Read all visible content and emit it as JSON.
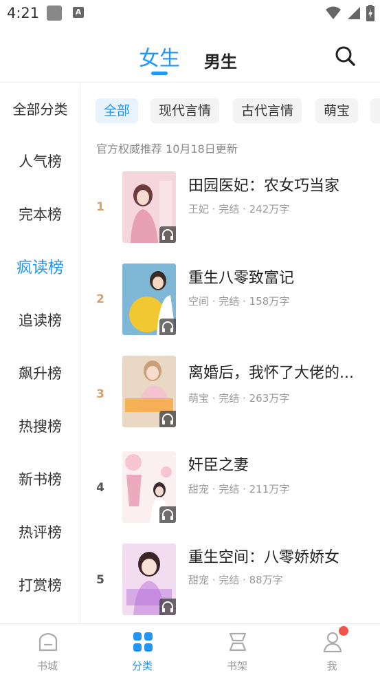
{
  "status_bar": {
    "time": "4:21",
    "a_label": "A"
  },
  "header": {
    "tabs": [
      {
        "label": "女生"
      },
      {
        "label": "男生"
      }
    ],
    "accent_color": "#2196f3"
  },
  "sidebar": {
    "all_label": "全部分类",
    "items": [
      {
        "label": "人气榜"
      },
      {
        "label": "完本榜"
      },
      {
        "label": "疯读榜"
      },
      {
        "label": "追读榜"
      },
      {
        "label": "飙升榜"
      },
      {
        "label": "热搜榜"
      },
      {
        "label": "新书榜"
      },
      {
        "label": "热评榜"
      },
      {
        "label": "打赏榜"
      }
    ],
    "active_label": "疯读榜"
  },
  "chips": [
    {
      "label": "全部"
    },
    {
      "label": "现代言情"
    },
    {
      "label": "古代言情"
    },
    {
      "label": "萌宝"
    },
    {
      "label": ""
    }
  ],
  "update_note": "官方权威推荐 10月18日更新",
  "books": [
    {
      "rank": "1",
      "title": "田园医妃：农女巧当家",
      "meta": "王妃 · 完结 · 242万字",
      "rank_color": "#d9a36a"
    },
    {
      "rank": "2",
      "title": "重生八零致富记",
      "meta": "空间 · 完结 · 158万字",
      "rank_color": "#d9a36a"
    },
    {
      "rank": "3",
      "title": "离婚后，我怀了大佬的...",
      "meta": "萌宝 · 完结 · 263万字",
      "rank_color": "#d9a36a"
    },
    {
      "rank": "4",
      "title": "奸臣之妻",
      "meta": "甜宠 · 完结 · 211万字",
      "rank_color": "#555555"
    },
    {
      "rank": "5",
      "title": "重生空间：八零娇娇女",
      "meta": "甜宠 · 完结 · 88万字",
      "rank_color": "#555555"
    }
  ],
  "bottom_nav": [
    {
      "label": "书城",
      "icon": "home-icon"
    },
    {
      "label": "分类",
      "icon": "category-icon"
    },
    {
      "label": "书架",
      "icon": "bookshelf-icon"
    },
    {
      "label": "我",
      "icon": "profile-icon"
    }
  ]
}
